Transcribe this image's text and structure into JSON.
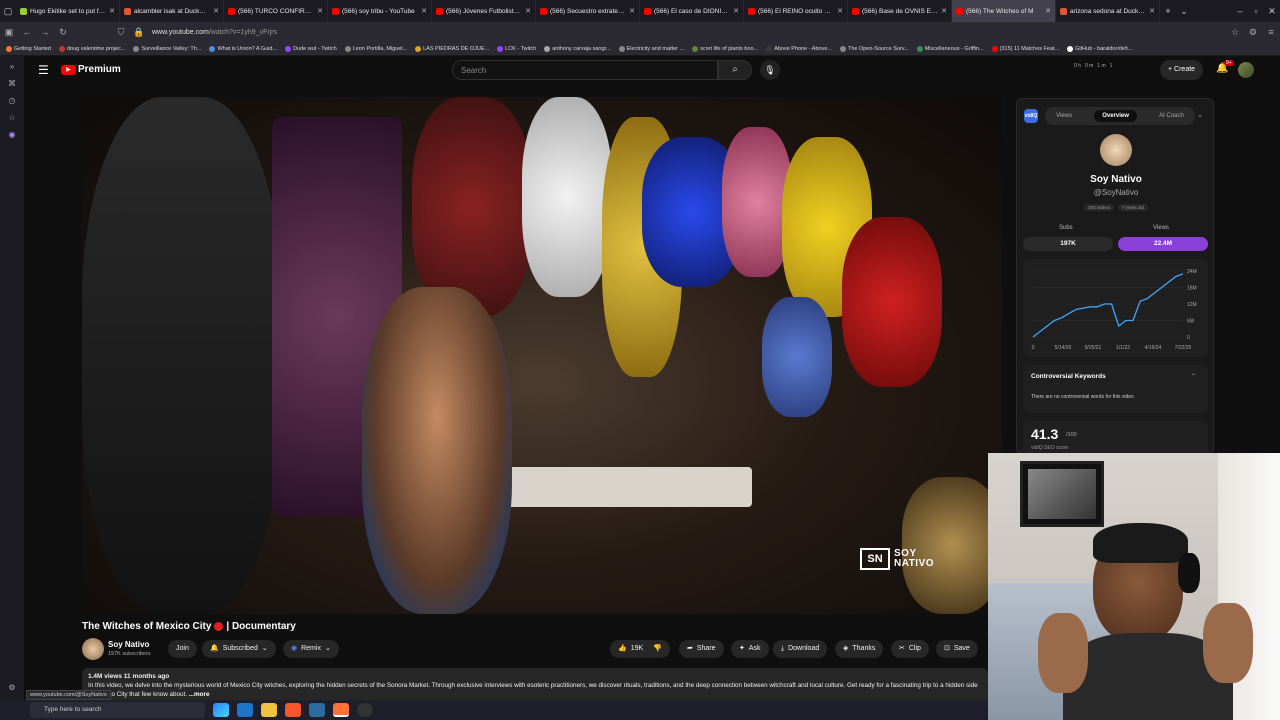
{
  "browser": {
    "tabs": [
      {
        "title": "Hugo Ekitike set to put finis",
        "color": "#9acd32"
      },
      {
        "title": "alcambler isak at DuckDuc",
        "color": "#de5833"
      },
      {
        "title": "(566) TURCO CONFIRMA M",
        "color": "#ff0000"
      },
      {
        "title": "(566) soy tribu - YouTube",
        "color": "#ff0000"
      },
      {
        "title": "(566) Jóvenes Futbolistas M",
        "color": "#ff0000"
      },
      {
        "title": "(566) Secuestro extraterrest",
        "color": "#ff0000"
      },
      {
        "title": "(566) El caso de DIONISIO L",
        "color": "#ff0000"
      },
      {
        "title": "(566) El REINO oculto Bajo",
        "color": "#ff0000"
      },
      {
        "title": "(566) Base de OVNIS El Mi",
        "color": "#ff0000"
      },
      {
        "title": "(566) The Witches of M",
        "color": "#ff0000",
        "active": true
      },
      {
        "title": "arizona sedona at DuckDuc",
        "color": "#de5833"
      }
    ],
    "url_host": "www.youtube.com",
    "url_path": "/watch?v=1yh9_vFrjrs",
    "bookmarks": [
      "Getting Started",
      "doug valentime projec...",
      "Surveillance Valley: Th...",
      "What is Union? A Guid...",
      "Dude wut - Twitch",
      "Leon Portilla, Miguel...",
      "LAS PIEDRAS DE OJUE...",
      "LCK - Twitch",
      "anthony carvaja sangr...",
      "Electricity and matter ...",
      "scret life of plants boo...",
      "Above Phone - Above...",
      "The Open-Source Surv...",
      "Miscellaneous - Griffin...",
      "(315) 11 Matches Feat...",
      "GitHub - baraldor/defi..."
    ],
    "status_url": "www.youtube.com/@SoyNativo"
  },
  "youtube": {
    "logo": "Premium",
    "search_placeholder": "Search",
    "create_label": "Create",
    "notif_count": "9+",
    "ext_stats": [
      "0 h",
      "0 m",
      "1 m",
      "1"
    ]
  },
  "video": {
    "title": "The Witches of Mexico City",
    "title_suffix": "| Documentary",
    "watermark_line1": "SOY",
    "watermark_line2": "NATIVO",
    "channel": "Soy Nativo",
    "subscribers": "197K subscribers",
    "join": "Join",
    "subscribed": "Subscribed",
    "remix": "Remix",
    "likes": "19K",
    "share": "Share",
    "ask": "Ask",
    "download": "Download",
    "thanks": "Thanks",
    "clip": "Clip",
    "save": "Save",
    "views_date": "1.4M views  11 months ago",
    "description": "In this video, we delve into the mysterious world of Mexico City witches, exploring the hidden secrets of the Sonora Market. Through exclusive interviews with esoteric practitioners, we discover rituals, traditions, and the deep connection between witchcraft and local culture. Get ready for a fascinating trip to a hidden side of Mexico City that few know about.",
    "more": "...more"
  },
  "panel": {
    "logo": "vidIQ",
    "tabs": [
      "Views",
      "Overview",
      "AI Coach"
    ],
    "channel_name": "Soy Nativo",
    "channel_handle": "@SoyNativo",
    "chips": [
      "293 videos",
      "7 years old"
    ],
    "subs_label": "Subs",
    "subs_value": "197K",
    "views_label": "Views",
    "views_value": "22.4M",
    "controversial_title": "Controversial Keywords",
    "controversial_text": "There are no controversial words for this video",
    "seo_score": "41.3",
    "seo_max": "/100",
    "seo_label": "vidIQ SEO score"
  },
  "taskbar": {
    "search_placeholder": "Type here to search"
  },
  "chart_data": {
    "type": "line",
    "x": [
      "5/14/20",
      "9/25/21",
      "1/1/23",
      "4/16/24",
      "7/22/25"
    ],
    "x_ticks": [
      "0",
      "5/14/20",
      "9/25/21",
      "1/1/23",
      "4/16/24",
      "7/22/25"
    ],
    "y_ticks": [
      "24M",
      "18M",
      "12M",
      "6M",
      "0"
    ],
    "ylim": [
      0,
      24
    ],
    "color": "#3ea6ff",
    "series": [
      {
        "values": [
          0,
          2,
          4,
          6,
          7,
          8.5,
          10,
          10.5,
          11,
          11,
          12,
          12,
          4,
          6,
          6,
          13,
          14,
          16,
          18,
          20,
          22,
          23
        ]
      }
    ]
  }
}
